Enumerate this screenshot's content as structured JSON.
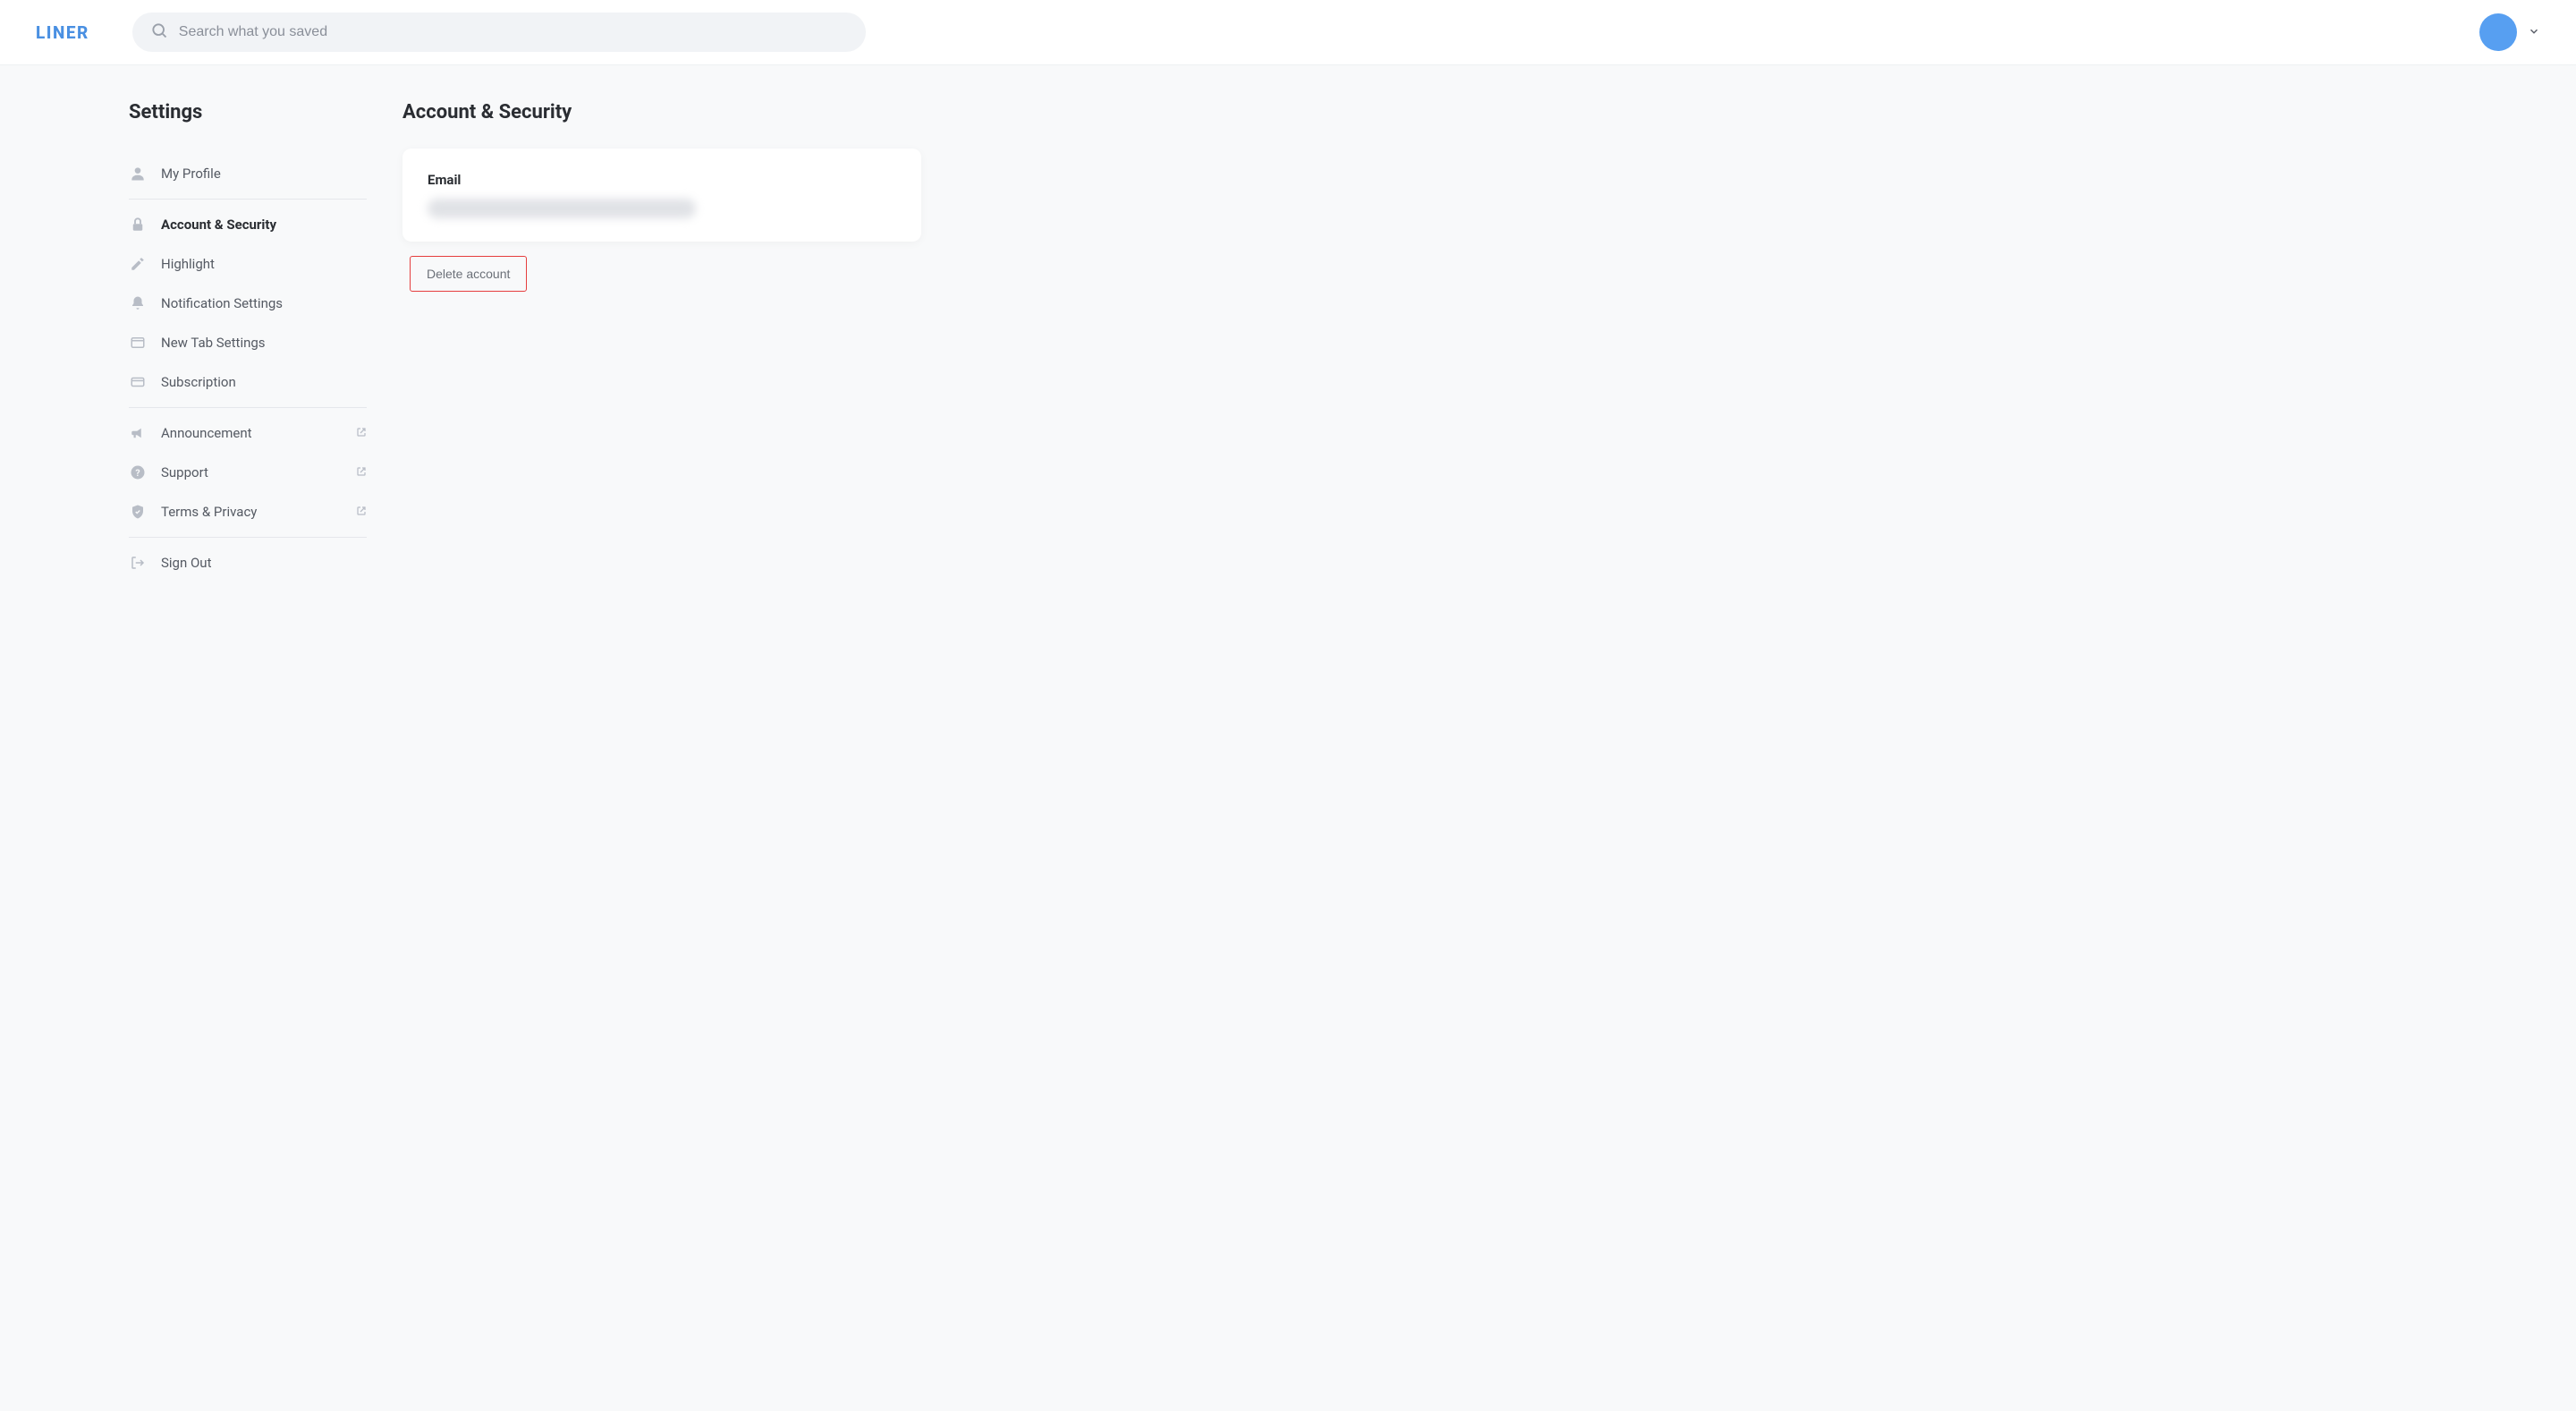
{
  "header": {
    "logo": "LINER",
    "search_placeholder": "Search what you saved"
  },
  "sidebar": {
    "title": "Settings",
    "sections": [
      {
        "items": [
          {
            "label": "My Profile",
            "icon": "person",
            "active": false
          }
        ]
      },
      {
        "items": [
          {
            "label": "Account & Security",
            "icon": "lock",
            "active": true
          },
          {
            "label": "Highlight",
            "icon": "pencil",
            "active": false
          },
          {
            "label": "Notification Settings",
            "icon": "bell",
            "active": false
          },
          {
            "label": "New Tab Settings",
            "icon": "tab",
            "active": false
          },
          {
            "label": "Subscription",
            "icon": "card",
            "active": false
          }
        ]
      },
      {
        "items": [
          {
            "label": "Announcement",
            "icon": "megaphone",
            "external": true
          },
          {
            "label": "Support",
            "icon": "question",
            "external": true
          },
          {
            "label": "Terms & Privacy",
            "icon": "shield",
            "external": true
          }
        ]
      },
      {
        "items": [
          {
            "label": "Sign Out",
            "icon": "signout"
          }
        ]
      }
    ]
  },
  "main": {
    "title": "Account & Security",
    "email_label": "Email",
    "delete_label": "Delete account"
  }
}
